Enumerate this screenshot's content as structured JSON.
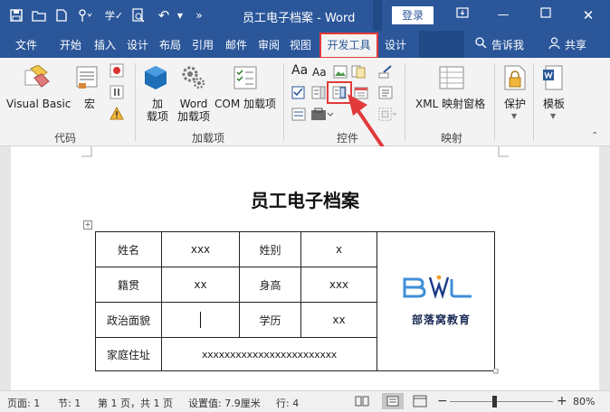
{
  "titlebar": {
    "title": "员工电子档案 - Word",
    "login_label": "登录",
    "quick_access": [
      "save-icon",
      "open-folder-icon",
      "new-doc-icon",
      "touch-mode-icon",
      "spelling-icon",
      "print-preview-icon",
      "undo-icon",
      "undo-dropdown-icon",
      "more-icon"
    ]
  },
  "tabs": [
    "文件",
    "开始",
    "插入",
    "设计",
    "布局",
    "引用",
    "邮件",
    "审阅",
    "视图",
    "开发工具",
    "设计",
    "布局"
  ],
  "tell_me": "告诉我",
  "share": "共享",
  "ribbon": {
    "code_group": {
      "label": "代码",
      "visual_basic": "Visual Basic",
      "macro": "宏"
    },
    "addins_group": {
      "label": "加载项",
      "addins": "加\n载项",
      "word_addins": "Word\n加载项",
      "com_addins": "COM 加载项"
    },
    "controls_group": {
      "label": "控件"
    },
    "mapping_group": {
      "label": "映射",
      "xml_pane": "XML 映射窗格"
    },
    "protect_group": {
      "protect": "保护"
    },
    "template_group": {
      "template": "模板"
    }
  },
  "document": {
    "heading": "员工电子档案",
    "table": {
      "row1": [
        "姓名",
        "xxx",
        "姓别",
        "x"
      ],
      "row2": [
        "籍贯",
        "xx",
        "身高",
        "xxx"
      ],
      "row3": [
        "政治面貌",
        "",
        "学历",
        "xx"
      ],
      "row4": [
        "家庭住址",
        "xxxxxxxxxxxxxxxxxxxxxxxx"
      ]
    },
    "logo": {
      "letters": "BLW",
      "caption": "部落窝教育"
    }
  },
  "statusbar": {
    "page": "页面: 1",
    "section": "节: 1",
    "pages": "第 1 页，共 1 页",
    "position": "设置值: 7.9厘米",
    "line": "行: 4",
    "zoom": "80%"
  },
  "colors": {
    "accent": "#2b579a",
    "highlight": "#e23a3a"
  }
}
